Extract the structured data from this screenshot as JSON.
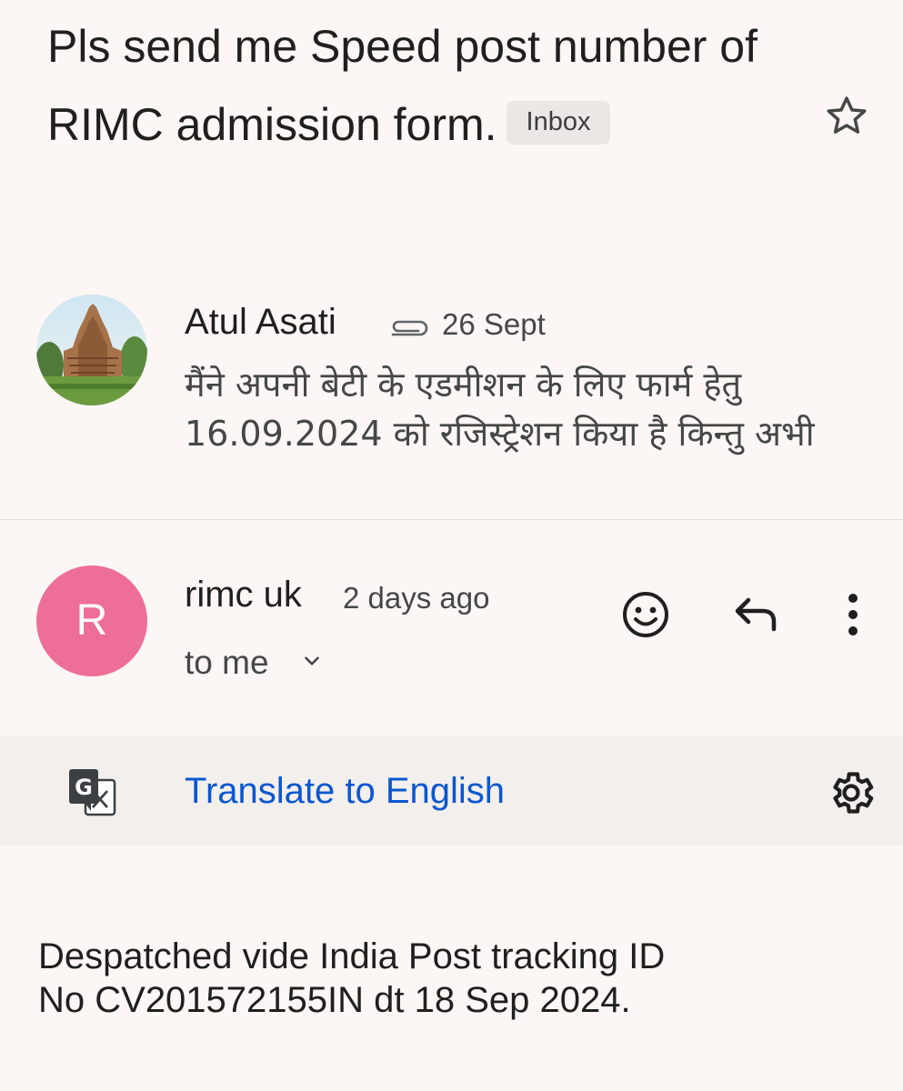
{
  "thread": {
    "subject": "Pls send me Speed post number of RIMC admission form.",
    "label": "Inbox"
  },
  "messages": [
    {
      "sender": "Atul Asati",
      "date": "26 Sept",
      "snippet": "मैंने अपनी बेटी के एडमीशन के लिए फार्म हेतु 16.09.2024 को रजिस्ट्रेशन किया है किन्तु अभी",
      "has_attachment": true,
      "avatar": "temple-photo-avatar"
    },
    {
      "sender": "rimc uk",
      "avatar_letter": "R",
      "avatar_color": "#ee6e9a",
      "date": "2 days ago",
      "recipient": "to me"
    }
  ],
  "translate": {
    "label": "Translate to English",
    "link_color": "#0b57d0"
  },
  "body": {
    "lines": [
      "Despatched vide India Post tracking ID",
      "No CV201572155IN dt 18 Sep 2024."
    ]
  },
  "icons": [
    "star-icon",
    "paperclip-icon",
    "chevron-down-icon",
    "emoji-icon",
    "reply-icon",
    "more-vert-icon",
    "translate-icon",
    "gear-icon"
  ]
}
